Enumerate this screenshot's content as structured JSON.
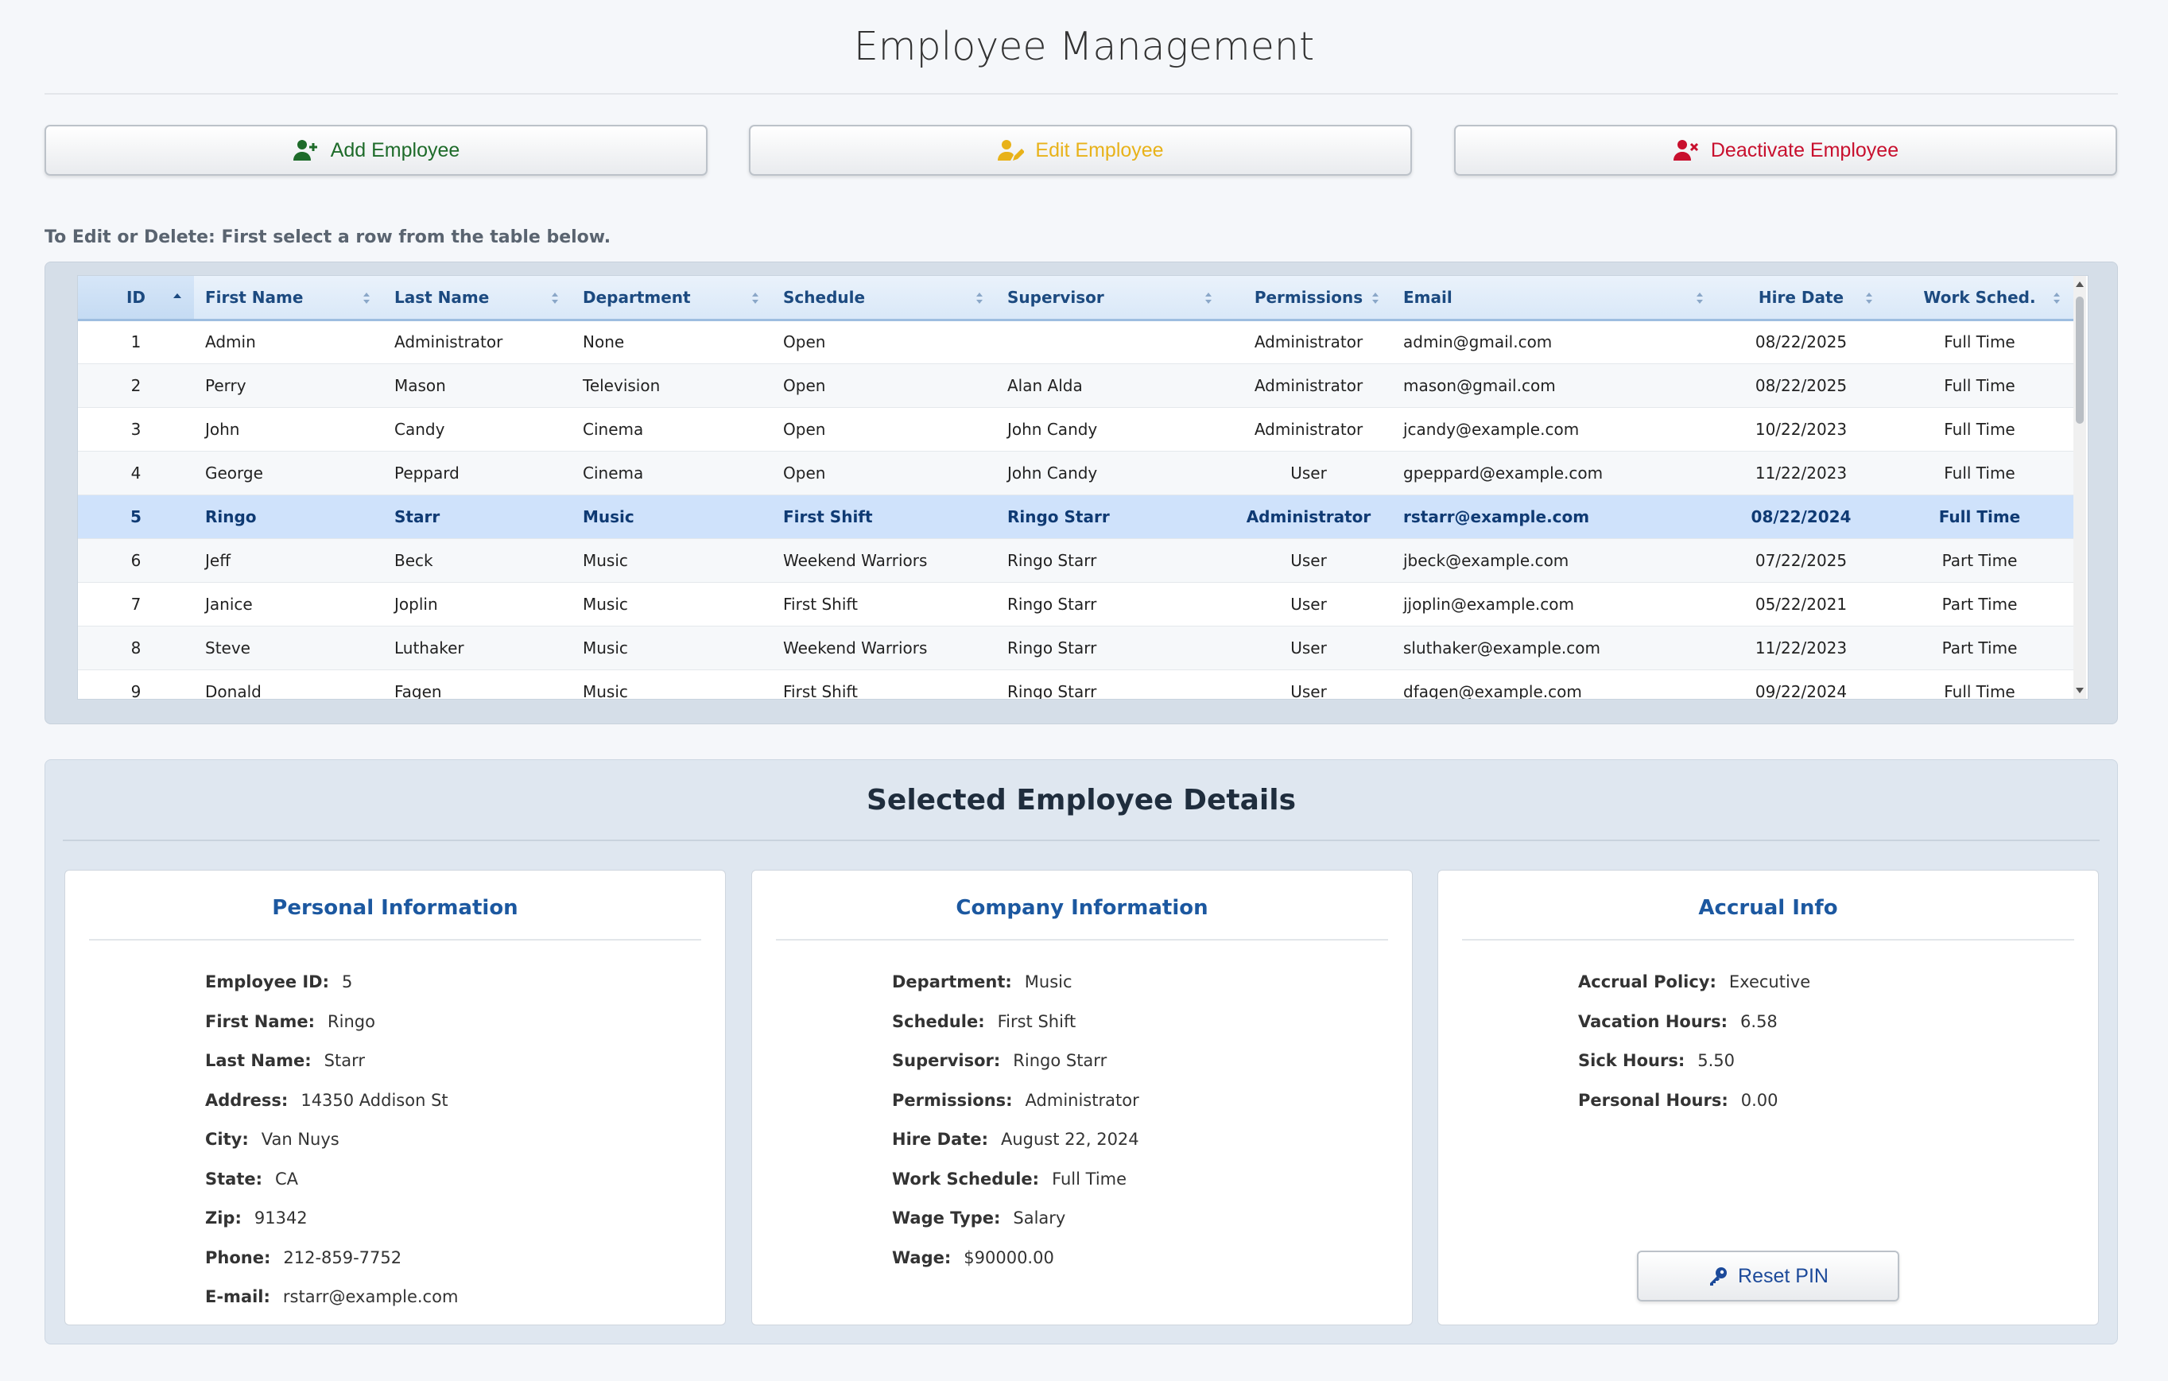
{
  "page": {
    "title": "Employee Management"
  },
  "toolbar": {
    "add_label": "Add Employee",
    "edit_label": "Edit Employee",
    "deactivate_label": "Deactivate Employee",
    "add_color": "#1e6b2a",
    "edit_color": "#e8b21a",
    "deactivate_color": "#c8102e"
  },
  "hint": "To Edit or Delete: First select a row from the table below.",
  "table": {
    "columns": [
      "ID",
      "First Name",
      "Last Name",
      "Department",
      "Schedule",
      "Supervisor",
      "Permissions",
      "Email",
      "Hire Date",
      "Work Sched."
    ],
    "sorted_column": "ID",
    "sort_direction": "ascending",
    "selected_row_id": "5",
    "rows": [
      {
        "id": "1",
        "first": "Admin",
        "last": "Administrator",
        "dept": "None",
        "schedule": "Open",
        "supervisor": "",
        "perm": "Administrator",
        "email": "admin@gmail.com",
        "hire": "08/22/2025",
        "work": "Full Time"
      },
      {
        "id": "2",
        "first": "Perry",
        "last": "Mason",
        "dept": "Television",
        "schedule": "Open",
        "supervisor": "Alan Alda",
        "perm": "Administrator",
        "email": "mason@gmail.com",
        "hire": "08/22/2025",
        "work": "Full Time"
      },
      {
        "id": "3",
        "first": "John",
        "last": "Candy",
        "dept": "Cinema",
        "schedule": "Open",
        "supervisor": "John Candy",
        "perm": "Administrator",
        "email": "jcandy@example.com",
        "hire": "10/22/2023",
        "work": "Full Time"
      },
      {
        "id": "4",
        "first": "George",
        "last": "Peppard",
        "dept": "Cinema",
        "schedule": "Open",
        "supervisor": "John Candy",
        "perm": "User",
        "email": "gpeppard@example.com",
        "hire": "11/22/2023",
        "work": "Full Time"
      },
      {
        "id": "5",
        "first": "Ringo",
        "last": "Starr",
        "dept": "Music",
        "schedule": "First Shift",
        "supervisor": "Ringo Starr",
        "perm": "Administrator",
        "email": "rstarr@example.com",
        "hire": "08/22/2024",
        "work": "Full Time"
      },
      {
        "id": "6",
        "first": "Jeff",
        "last": "Beck",
        "dept": "Music",
        "schedule": "Weekend Warriors",
        "supervisor": "Ringo Starr",
        "perm": "User",
        "email": "jbeck@example.com",
        "hire": "07/22/2025",
        "work": "Part Time"
      },
      {
        "id": "7",
        "first": "Janice",
        "last": "Joplin",
        "dept": "Music",
        "schedule": "First Shift",
        "supervisor": "Ringo Starr",
        "perm": "User",
        "email": "jjoplin@example.com",
        "hire": "05/22/2021",
        "work": "Part Time"
      },
      {
        "id": "8",
        "first": "Steve",
        "last": "Luthaker",
        "dept": "Music",
        "schedule": "Weekend Warriors",
        "supervisor": "Ringo Starr",
        "perm": "User",
        "email": "sluthaker@example.com",
        "hire": "11/22/2023",
        "work": "Part Time"
      },
      {
        "id": "9",
        "first": "Donald",
        "last": "Fagen",
        "dept": "Music",
        "schedule": "First Shift",
        "supervisor": "Ringo Starr",
        "perm": "User",
        "email": "dfagen@example.com",
        "hire": "09/22/2024",
        "work": "Full Time"
      }
    ]
  },
  "details": {
    "title": "Selected Employee Details",
    "personal": {
      "title": "Personal Information",
      "fields": [
        {
          "label": "Employee ID:",
          "value": "5"
        },
        {
          "label": "First Name:",
          "value": "Ringo"
        },
        {
          "label": "Last Name:",
          "value": "Starr"
        },
        {
          "label": "Address:",
          "value": "14350 Addison St"
        },
        {
          "label": "City:",
          "value": "Van Nuys"
        },
        {
          "label": "State:",
          "value": "CA"
        },
        {
          "label": "Zip:",
          "value": "91342"
        },
        {
          "label": "Phone:",
          "value": "212-859-7752"
        },
        {
          "label": "E-mail:",
          "value": "rstarr@example.com"
        }
      ]
    },
    "company": {
      "title": "Company Information",
      "fields": [
        {
          "label": "Department:",
          "value": "Music"
        },
        {
          "label": "Schedule:",
          "value": "First Shift"
        },
        {
          "label": "Supervisor:",
          "value": "Ringo Starr"
        },
        {
          "label": "Permissions:",
          "value": "Administrator"
        },
        {
          "label": "Hire Date:",
          "value": "August 22, 2024"
        },
        {
          "label": "Work Schedule:",
          "value": "Full Time"
        },
        {
          "label": "Wage Type:",
          "value": "Salary"
        },
        {
          "label": "Wage:",
          "value": "$90000.00"
        }
      ]
    },
    "accrual": {
      "title": "Accrual Info",
      "fields": [
        {
          "label": "Accrual Policy:",
          "value": "Executive"
        },
        {
          "label": "Vacation Hours:",
          "value": "6.58"
        },
        {
          "label": "Sick Hours:",
          "value": "5.50"
        },
        {
          "label": "Personal Hours:",
          "value": "0.00"
        }
      ],
      "reset_label": "Reset PIN"
    }
  },
  "icons": {
    "add": "user-plus-icon",
    "edit": "user-edit-icon",
    "deactivate": "user-remove-icon",
    "reset": "key-icon",
    "sort": "sort-arrows-icon"
  }
}
